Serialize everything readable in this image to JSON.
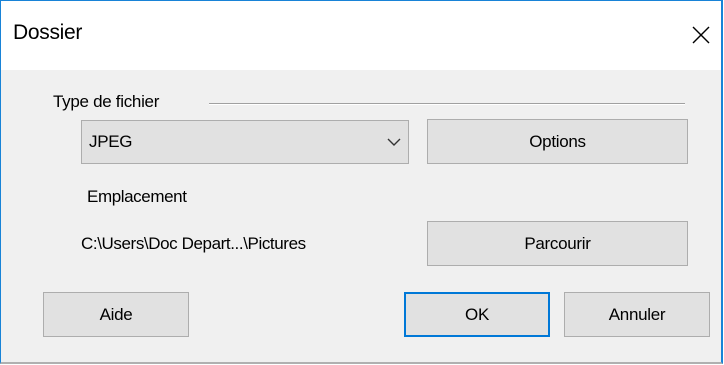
{
  "dialog": {
    "title": "Dossier",
    "close_label": "Close",
    "colors": {
      "accent_border": "#1883d7",
      "default_button_border": "#0078d7",
      "button_face": "#e1e1e1",
      "dialog_background": "#f0f0f0"
    }
  },
  "file_type": {
    "group_label": "Type de fichier",
    "selected_value": "JPEG",
    "options_button": "Options"
  },
  "location": {
    "label": "Emplacement",
    "path": "C:\\Users\\Doc Depart...\\Pictures",
    "browse_button": "Parcourir"
  },
  "footer": {
    "help_button": "Aide",
    "ok_button": "OK",
    "cancel_button": "Annuler"
  },
  "icons": {
    "close": "close-icon",
    "dropdown": "chevron-down-icon"
  }
}
